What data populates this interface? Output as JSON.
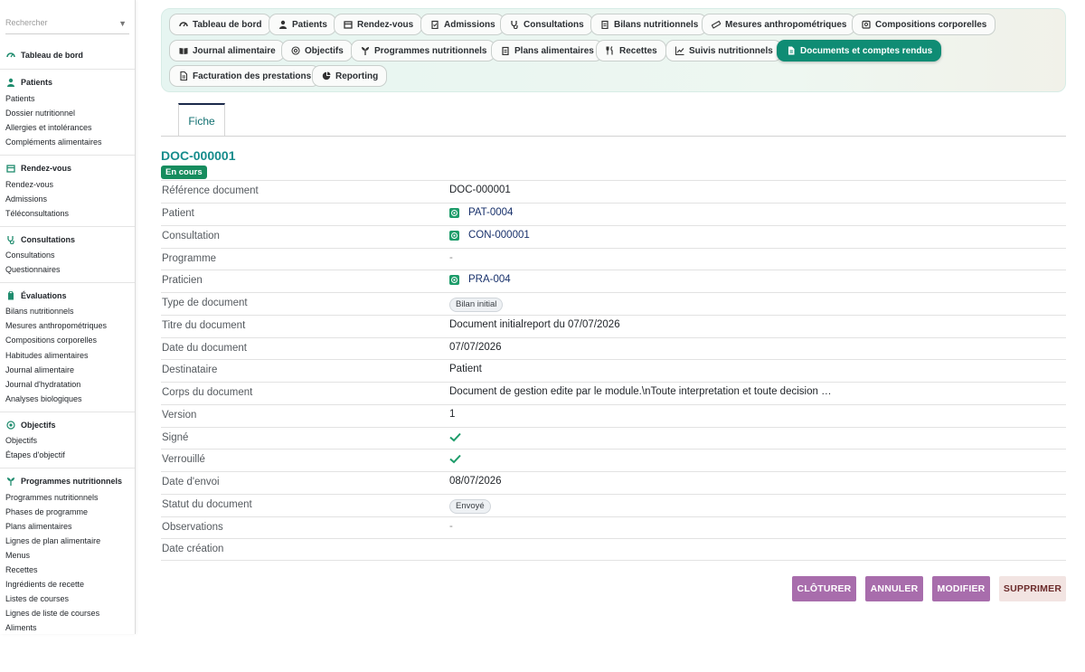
{
  "sidebar": {
    "search_placeholder": "Rechercher",
    "dashboard_label": "Tableau de bord",
    "sections": {
      "patients": {
        "title": "Patients",
        "items": [
          "Patients",
          "Dossier nutritionnel",
          "Allergies et intolérances",
          "Compléments alimentaires"
        ]
      },
      "rdv": {
        "title": "Rendez-vous",
        "items": [
          "Rendez-vous",
          "Admissions",
          "Téléconsultations"
        ]
      },
      "consult": {
        "title": "Consultations",
        "items": [
          "Consultations",
          "Questionnaires"
        ]
      },
      "eval": {
        "title": "Évaluations",
        "items": [
          "Bilans nutritionnels",
          "Mesures anthropométriques",
          "Compositions corporelles",
          "Habitudes alimentaires",
          "Journal alimentaire",
          "Journal d'hydratation",
          "Analyses biologiques"
        ]
      },
      "obj": {
        "title": "Objectifs",
        "items": [
          "Objectifs",
          "Étapes d'objectif"
        ]
      },
      "prog": {
        "title": "Programmes nutritionnels",
        "items": [
          "Programmes nutritionnels",
          "Phases de programme",
          "Plans alimentaires",
          "Lignes de plan alimentaire",
          "Menus",
          "Recettes",
          "Ingrédients de recette",
          "Listes de courses",
          "Lignes de liste de courses",
          "Aliments"
        ]
      }
    }
  },
  "nav": {
    "items": [
      "Tableau de bord",
      "Patients",
      "Rendez-vous",
      "Admissions",
      "Consultations",
      "Bilans nutritionnels",
      "Mesures anthropométriques",
      "Compositions corporelles",
      "Journal alimentaire",
      "Objectifs",
      "Programmes nutritionnels",
      "Plans alimentaires",
      "Recettes",
      "Suivis nutritionnels",
      "Documents et comptes rendus",
      "Facturation des prestations",
      "Reporting"
    ],
    "active": "Documents et comptes rendus"
  },
  "tabs": {
    "fiche": "Fiche"
  },
  "record": {
    "title": "DOC-000001",
    "status": "En cours",
    "fields": [
      {
        "label": "Référence document",
        "value": "DOC-000001"
      },
      {
        "label": "Patient",
        "value": "PAT-0004"
      },
      {
        "label": "Consultation",
        "value": "CON-000001"
      },
      {
        "label": "Programme",
        "value": "-"
      },
      {
        "label": "Praticien",
        "value": "PRA-004"
      },
      {
        "label": "Type de document",
        "value": "Bilan initial"
      },
      {
        "label": "Titre du document",
        "value": "Document initialreport du 07/07/2026"
      },
      {
        "label": "Date du document",
        "value": "07/07/2026"
      },
      {
        "label": "Destinataire",
        "value": "Patient"
      },
      {
        "label": "Corps du document",
        "value": "Document de gestion edite par le module.\\nToute interpretation et toute decision …"
      },
      {
        "label": "Version",
        "value": "1"
      },
      {
        "label": "Signé",
        "value": true
      },
      {
        "label": "Verrouillé",
        "value": true
      },
      {
        "label": "Date d'envoi",
        "value": "08/07/2026"
      },
      {
        "label": "Statut du document",
        "value": "Envoyé"
      },
      {
        "label": "Observations",
        "value": "-"
      },
      {
        "label": "Date création",
        "value": ""
      }
    ]
  },
  "actions": {
    "close": "CLÔTURER",
    "cancel": "ANNULER",
    "edit": "MODIFIER",
    "delete": "SUPPRIMER"
  },
  "colors": {
    "accent": "#0f8c74",
    "title": "#168c8c",
    "status": "#168c5e",
    "action": "#a86dac",
    "check": "#1d9c6a"
  }
}
